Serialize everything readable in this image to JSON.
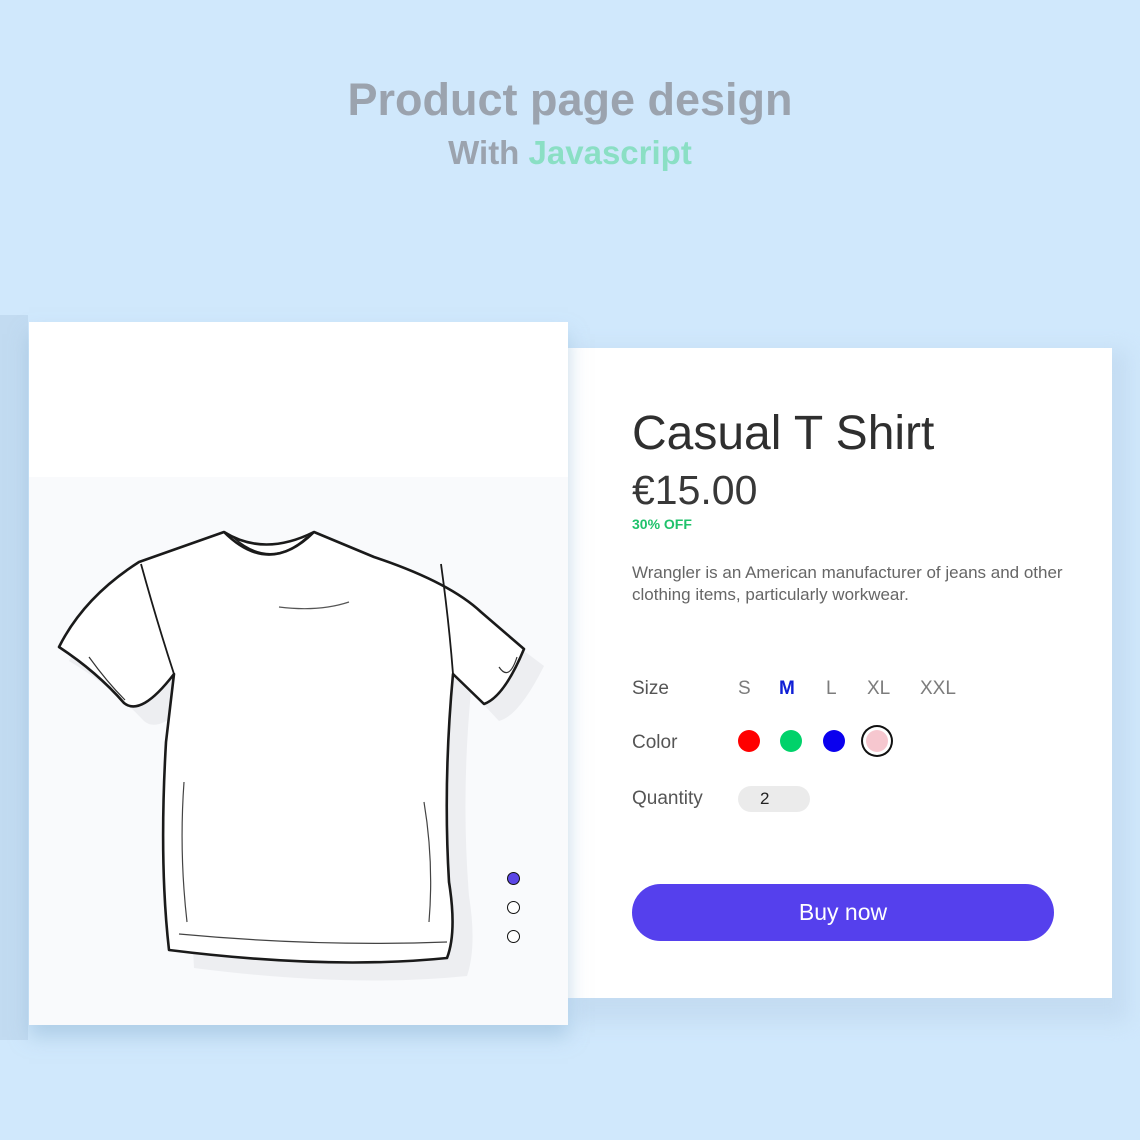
{
  "header": {
    "title": "Product page design",
    "subtitle_prefix": "With",
    "subtitle_accent": "Javascript"
  },
  "product": {
    "name": "Casual T Shirt",
    "price": "€15.00",
    "discount": "30% OFF",
    "description": "Wrangler is an American manufacturer of jeans and other clothing items, particularly workwear."
  },
  "options": {
    "size_label": "Size",
    "sizes": [
      "S",
      "M",
      "L",
      "XL",
      "XXL"
    ],
    "selected_size": "M",
    "color_label": "Color",
    "colors": [
      "#ff0000",
      "#00d26a",
      "#0a00ee",
      "#f6c7cf"
    ],
    "selected_color_index": 3,
    "quantity_label": "Quantity",
    "quantity_value": "2"
  },
  "actions": {
    "buy_label": "Buy now"
  },
  "gallery": {
    "image_icon": "t-shirt-icon",
    "slide_count": 3,
    "active_slide": 0
  },
  "theme": {
    "accent": "#5540ed",
    "discount": "#1fc26b",
    "background": "#d0e8fc"
  }
}
